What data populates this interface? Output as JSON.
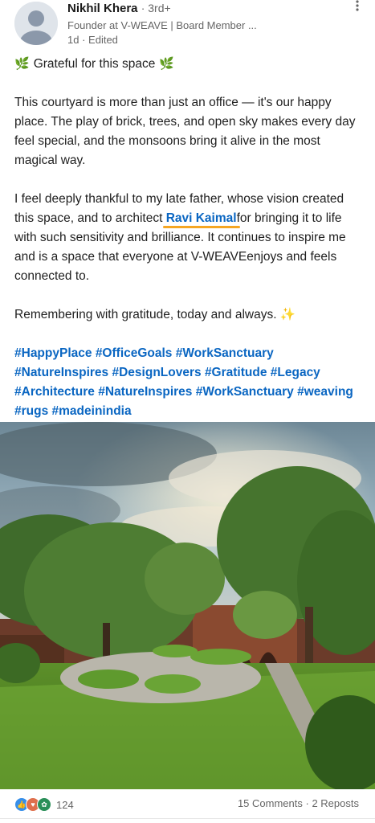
{
  "author": {
    "name": "Nikhil Khera",
    "degree": "3rd+",
    "headline": "Founder at V-WEAVE | Board Member ...",
    "time": "1d",
    "edited": "Edited"
  },
  "post": {
    "title": "Grateful for this space",
    "paragraph1": "This courtyard is more than just an office — it's our happy place. The play of brick, trees, and open sky makes every day feel special, and the monsoons bring it alive in the most magical way.",
    "paragraph2_before": "I feel deeply thankful to my late father, whose vision created this space, and to architect ",
    "mention": "Ravi Kaimal",
    "paragraph2_after": "for bringing it to life with such sensitivity and brilliance. It continues to inspire me and is a space that everyone at V-WEAVEenjoys and feels connected to.",
    "paragraph3": "Remembering with gratitude, today and always.",
    "hashtags": [
      "#HappyPlace",
      "#OfficeGoals",
      "#WorkSanctuary",
      "#NatureInspires",
      "#DesignLovers",
      "#Gratitude",
      "#Legacy",
      "#Architecture",
      "#NatureInspires",
      "#WorkSanctuary",
      "#weaving",
      "#rugs",
      "#madeinindia"
    ]
  },
  "social": {
    "reaction_count": "124",
    "comments": "15 Comments",
    "separator": "·",
    "reposts": "2 Reposts"
  },
  "icons": {
    "more": "more-options-icon",
    "leaf": "herb-emoji",
    "sparkle": "sparkles-emoji",
    "reactions": [
      "like-icon",
      "love-icon",
      "support-icon"
    ]
  },
  "colors": {
    "link": "#0a66c2",
    "mention_underline": "#f5a623",
    "like": "#378fe9",
    "love": "#df704d",
    "support": "#2a8f58"
  }
}
